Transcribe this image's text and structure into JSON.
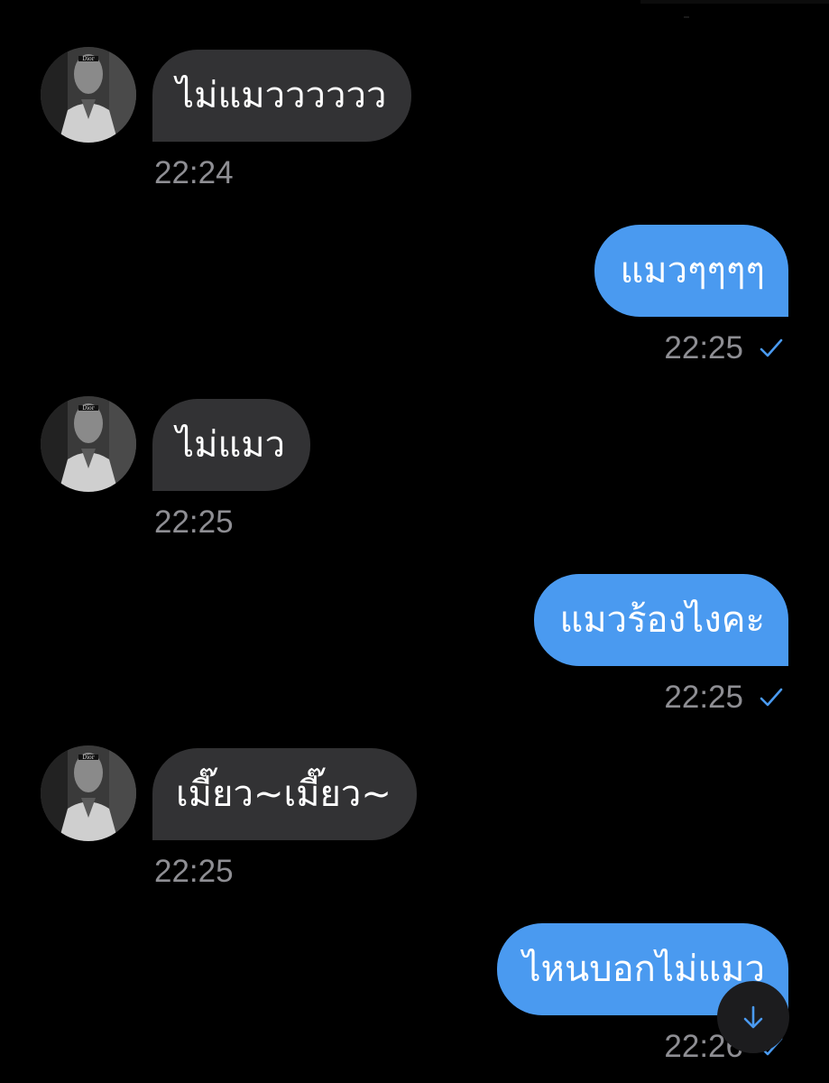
{
  "messages": [
    {
      "id": "m1",
      "direction": "incoming",
      "text": "ไม่แมวววววว",
      "time": "22:24"
    },
    {
      "id": "m2",
      "direction": "outgoing",
      "text": "แมวๆๆๆๆ",
      "time": "22:25",
      "status": "sent"
    },
    {
      "id": "m3",
      "direction": "incoming",
      "text": "ไม่แมว",
      "time": "22:25"
    },
    {
      "id": "m4",
      "direction": "outgoing",
      "text": "แมวร้องไงคะ",
      "time": "22:25",
      "status": "sent"
    },
    {
      "id": "m5",
      "direction": "incoming",
      "text": "เมี๊ยว~เมี๊ยว~",
      "time": "22:25"
    },
    {
      "id": "m6",
      "direction": "outgoing",
      "text": "ไหนบอกไม่แมว",
      "time": "22:26",
      "status": "sent"
    }
  ],
  "avatar_logo_text": "Dior",
  "colors": {
    "background": "#000000",
    "incoming_bubble": "#323234",
    "outgoing_bubble": "#4a9af0",
    "timestamp": "#8e8e93",
    "read_check": "#4a9af0"
  },
  "icons": {
    "scroll_down": "arrow-down-icon",
    "sent_status": "checkmark-icon"
  }
}
